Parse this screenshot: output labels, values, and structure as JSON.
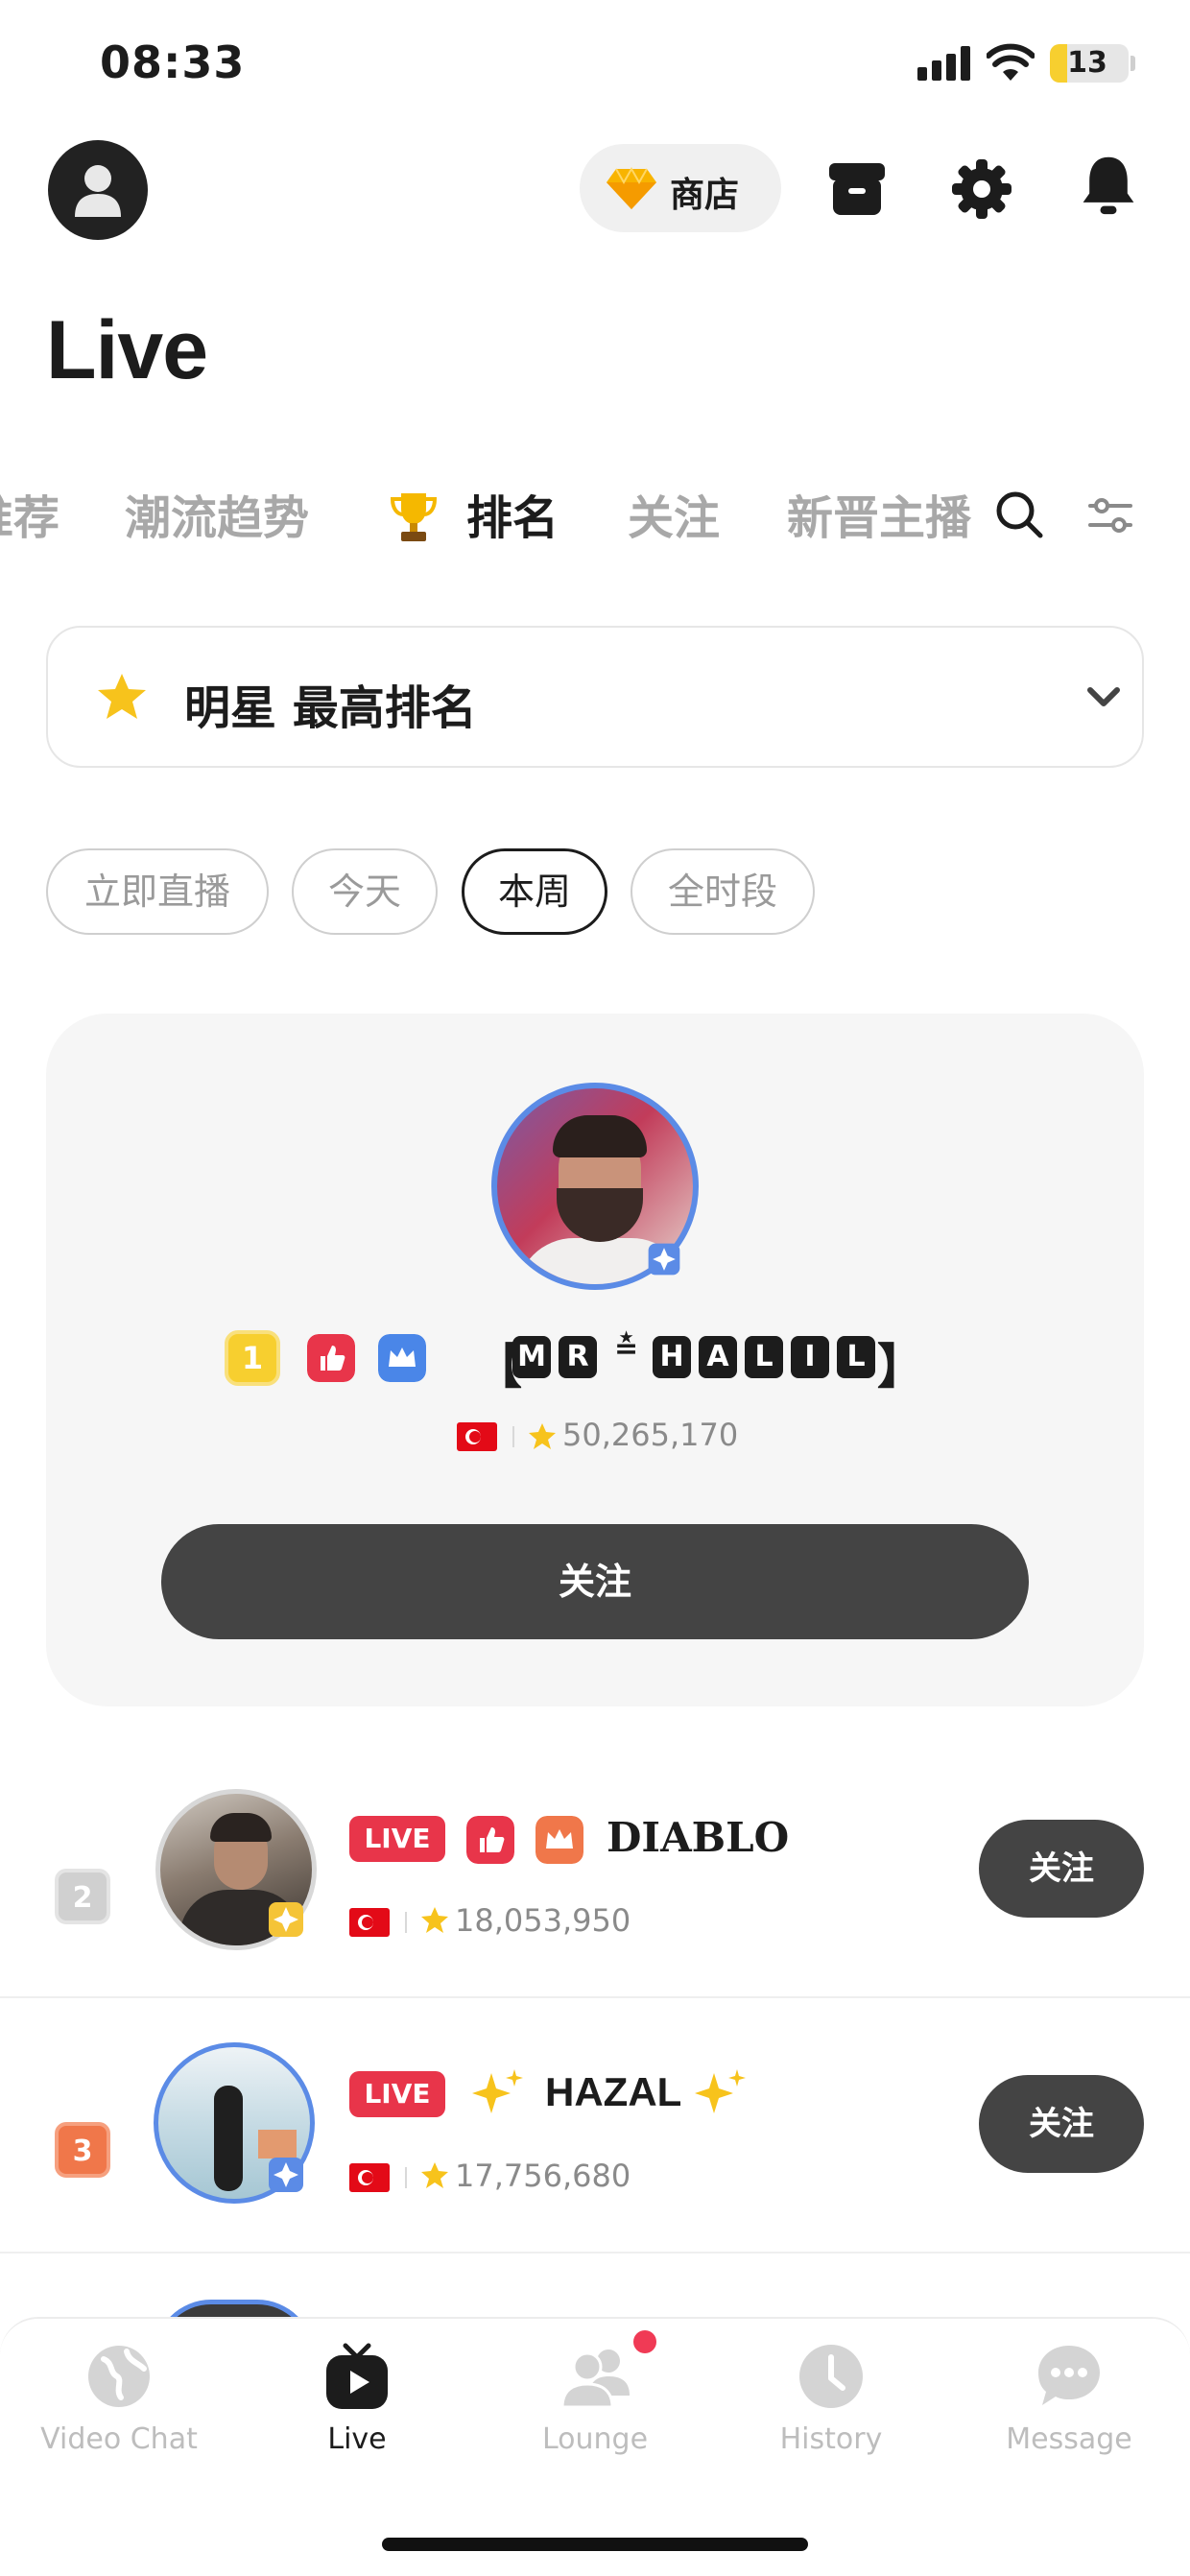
{
  "status_bar": {
    "time": "08:33",
    "battery": "13",
    "battery_level": 0.13
  },
  "header": {
    "shop_label": "商店",
    "title": "Live"
  },
  "tabs": [
    {
      "label": "推荐",
      "active": false
    },
    {
      "label": "潮流趋势",
      "active": false
    },
    {
      "label": "排名",
      "active": true
    },
    {
      "label": "关注",
      "active": false
    },
    {
      "label": "新晋主播",
      "active": false
    }
  ],
  "ranking_selector": {
    "label": "明星 最高排名"
  },
  "periods": [
    {
      "label": "立即直播",
      "active": false
    },
    {
      "label": "今天",
      "active": false
    },
    {
      "label": "本周",
      "active": true
    },
    {
      "label": "全时段",
      "active": false
    }
  ],
  "top_ranked": {
    "rank": "1",
    "name_letters": [
      "M",
      "R",
      "H",
      "A",
      "L",
      "I",
      "L"
    ],
    "score": "50,265,170",
    "follow_label": "关注"
  },
  "rows": [
    {
      "rank": "2",
      "live": "LIVE",
      "name": "DIABLO",
      "score": "18,053,950",
      "follow_label": "关注"
    },
    {
      "rank": "3",
      "live": "LIVE",
      "name": "HAZAL",
      "score": "17,756,680",
      "follow_label": "关注"
    }
  ],
  "bottom_nav": [
    {
      "label": "Video Chat",
      "icon": "globe-icon",
      "active": false
    },
    {
      "label": "Live",
      "icon": "tv-icon",
      "active": true
    },
    {
      "label": "Lounge",
      "icon": "people-icon",
      "active": false
    },
    {
      "label": "History",
      "icon": "clock-icon",
      "active": false
    },
    {
      "label": "Message",
      "icon": "chat-icon",
      "active": false
    }
  ],
  "colors": {
    "accent_live": "#e8354a",
    "gold": "#f7cf2f",
    "bronze": "#f0774a",
    "dark_button": "#444444"
  }
}
